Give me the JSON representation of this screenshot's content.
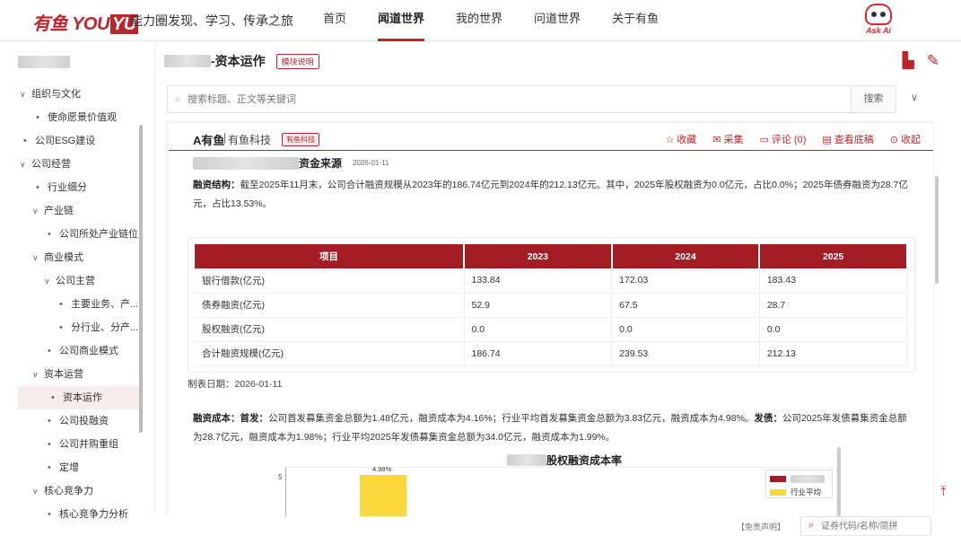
{
  "header": {
    "logo_text": "有鱼",
    "logo_latin_a": "YOU",
    "logo_latin_b": "YU",
    "slogan": "能力圈发现、学习、传承之旅",
    "nav": [
      {
        "label": "首页",
        "active": false
      },
      {
        "label": "闻道世界",
        "active": true
      },
      {
        "label": "我的世界",
        "active": false
      },
      {
        "label": "问道世界",
        "active": false
      },
      {
        "label": "关于有鱼",
        "active": false
      }
    ],
    "askai_label": "Ask Ai"
  },
  "sidebar": {
    "items": [
      {
        "label": "组织与文化",
        "level": 0,
        "type": "expanded"
      },
      {
        "label": "使命愿景价值观",
        "level": 1,
        "type": "leaf"
      },
      {
        "label": "公司ESG建设",
        "level": 0,
        "type": "leaf"
      },
      {
        "label": "公司经营",
        "level": 0,
        "type": "expanded"
      },
      {
        "label": "行业细分",
        "level": 1,
        "type": "leaf"
      },
      {
        "label": "产业链",
        "level": 1,
        "type": "expanded"
      },
      {
        "label": "公司所处产业链位...",
        "level": 2,
        "type": "leaf"
      },
      {
        "label": "商业模式",
        "level": 1,
        "type": "expanded"
      },
      {
        "label": "公司主营",
        "level": 2,
        "type": "expanded"
      },
      {
        "label": "主要业务、产...",
        "level": 3,
        "type": "leaf"
      },
      {
        "label": "分行业、分产...",
        "level": 3,
        "type": "leaf"
      },
      {
        "label": "公司商业模式",
        "level": 2,
        "type": "leaf"
      },
      {
        "label": "资本运营",
        "level": 1,
        "type": "expanded"
      },
      {
        "label": "资本运作",
        "level": 2,
        "type": "leaf",
        "selected": true
      },
      {
        "label": "公司投融资",
        "level": 2,
        "type": "leaf"
      },
      {
        "label": "公司并购重组",
        "level": 2,
        "type": "leaf"
      },
      {
        "label": "定增",
        "level": 2,
        "type": "leaf"
      },
      {
        "label": "核心竞争力",
        "level": 1,
        "type": "expanded"
      },
      {
        "label": "核心竞争力分析",
        "level": 2,
        "type": "leaf"
      }
    ]
  },
  "main": {
    "title_suffix": "-资本运作",
    "module_tag": "模块说明",
    "search_placeholder": "搜索标题、正文等关键词",
    "search_button": "搜索"
  },
  "card": {
    "brand": "A有鱼",
    "brand_sep": "|",
    "brand_name": "有鱼科技",
    "brand_tag": "有鱼科技",
    "actions": [
      {
        "icon": "star-icon",
        "glyph": "☆",
        "label": "收藏"
      },
      {
        "icon": "collect-icon",
        "glyph": "✉",
        "label": "采集"
      },
      {
        "icon": "comment-icon",
        "glyph": "▭",
        "label": "评论 (0)"
      },
      {
        "icon": "document-icon",
        "glyph": "▤",
        "label": "查看底稿"
      },
      {
        "icon": "collapse-icon",
        "glyph": "⊙",
        "label": "收起"
      }
    ],
    "section_title": "资金来源",
    "section_date": "2026-01-11",
    "para1_label": "融资结构：",
    "para1_text": "截至2025年11月末，公司合计融资规模从2023年的186.74亿元到2024年的212.13亿元。其中，2025年股权融资为0.0亿元，占比0.0%；2025年债券融资为28.7亿元，占比13.53%。",
    "table": {
      "headers": [
        "项目",
        "2023",
        "2024",
        "2025"
      ],
      "rows": [
        [
          "银行借款(亿元)",
          "133.84",
          "172.03",
          "183.43"
        ],
        [
          "债券融资(亿元)",
          "52.9",
          "67.5",
          "28.7"
        ],
        [
          "股权融资(亿元)",
          "0.0",
          "0.0",
          "0.0"
        ],
        [
          "合计融资规模(亿元)",
          "186.74",
          "239.53",
          "212.13"
        ]
      ]
    },
    "table_date": "制表日期：2026-01-11",
    "para2_label": "融资成本：",
    "para2_label2": "首发：",
    "para2_text_a": "公司首发募集资金总额为1.48亿元，融资成本为4.16%；行业平均首发募集资金总额为3.83亿元，融资成本为4.98%。",
    "para2_label3": "发债：",
    "para2_text_b": "公司2025年发债募集资金总额为28.7亿元，融资成本为1.98%；行业平均2025年发债募集资金总额为34.0亿元，融资成本为1.99%。"
  },
  "chart_data": {
    "type": "bar",
    "title": "股权融资成本率",
    "ytick_labels": [
      "5"
    ],
    "series": [
      {
        "name": "",
        "color": "#a31d24",
        "values": []
      },
      {
        "name": "行业平均",
        "color": "#fbd83c",
        "values": [
          4.98
        ]
      }
    ],
    "data_labels": [
      "4.98%"
    ]
  },
  "footer": {
    "disclaimer": "【免责声明】",
    "stock_placeholder": "证券代码/名称/简拼"
  },
  "colors": {
    "brand": "#c0242b",
    "table_header": "#a31d24",
    "bar_yellow": "#fbd83c"
  }
}
